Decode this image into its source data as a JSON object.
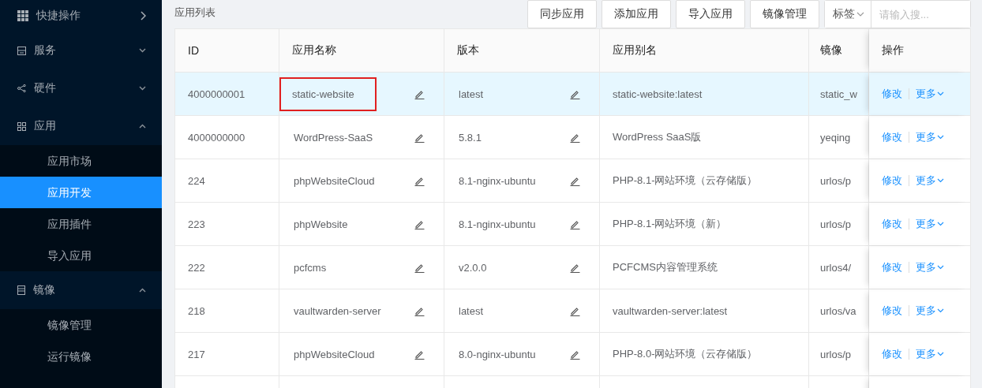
{
  "sidebar": {
    "groups": [
      {
        "label": "快捷操作",
        "kind": "flyout"
      },
      {
        "label": "服务",
        "kind": "submenu",
        "expanded": false
      },
      {
        "label": "硬件",
        "kind": "submenu",
        "expanded": false
      },
      {
        "label": "应用",
        "kind": "submenu",
        "expanded": true,
        "children": [
          {
            "label": "应用市场",
            "selected": false
          },
          {
            "label": "应用开发",
            "selected": true
          },
          {
            "label": "应用插件",
            "selected": false
          },
          {
            "label": "导入应用",
            "selected": false
          }
        ]
      },
      {
        "label": "镜像",
        "kind": "submenu",
        "expanded": true,
        "children": [
          {
            "label": "镜像管理",
            "selected": false
          },
          {
            "label": "运行镜像",
            "selected": false
          }
        ]
      }
    ]
  },
  "page": {
    "title": "应用列表",
    "buttons": [
      "同步应用",
      "添加应用",
      "导入应用",
      "镜像管理"
    ],
    "filter": {
      "label": "标签"
    },
    "search": {
      "placeholder": "请输入搜..."
    }
  },
  "table": {
    "columns": [
      "ID",
      "应用名称",
      "版本",
      "应用别名",
      "镜像",
      "操作"
    ],
    "rows": [
      {
        "id": "4000000001",
        "name": "static-website",
        "version": "latest",
        "alias": "static-website:latest",
        "image": "static_w",
        "selected": true,
        "highlighted": true,
        "actions": [
          "修改",
          "更多"
        ]
      },
      {
        "id": "4000000000",
        "name": "WordPress-SaaS",
        "version": "5.8.1",
        "alias": "WordPress SaaS版",
        "image": "yeqing",
        "selected": false,
        "highlighted": false,
        "actions": [
          "修改",
          "更多"
        ]
      },
      {
        "id": "224",
        "name": "phpWebsiteCloud",
        "version": "8.1-nginx-ubuntu",
        "alias": "PHP-8.1-网站环境（云存储版）",
        "image": "urlos/p",
        "selected": false,
        "highlighted": false,
        "actions": [
          "修改",
          "更多"
        ]
      },
      {
        "id": "223",
        "name": "phpWebsite",
        "version": "8.1-nginx-ubuntu",
        "alias": "PHP-8.1-网站环境（新）",
        "image": "urlos/p",
        "selected": false,
        "highlighted": false,
        "actions": [
          "修改",
          "更多"
        ]
      },
      {
        "id": "222",
        "name": "pcfcms",
        "version": "v2.0.0",
        "alias": "PCFCMS内容管理系统",
        "image": "urlos4/",
        "selected": false,
        "highlighted": false,
        "actions": [
          "修改",
          "更多"
        ]
      },
      {
        "id": "218",
        "name": "vaultwarden-server",
        "version": "latest",
        "alias": "vaultwarden-server:latest",
        "image": "urlos/va",
        "selected": false,
        "highlighted": false,
        "actions": [
          "修改",
          "更多"
        ]
      },
      {
        "id": "217",
        "name": "phpWebsiteCloud",
        "version": "8.0-nginx-ubuntu",
        "alias": "PHP-8.0-网站环境（云存储版）",
        "image": "urlos/p",
        "selected": false,
        "highlighted": false,
        "actions": [
          "修改",
          "更多"
        ]
      }
    ]
  }
}
